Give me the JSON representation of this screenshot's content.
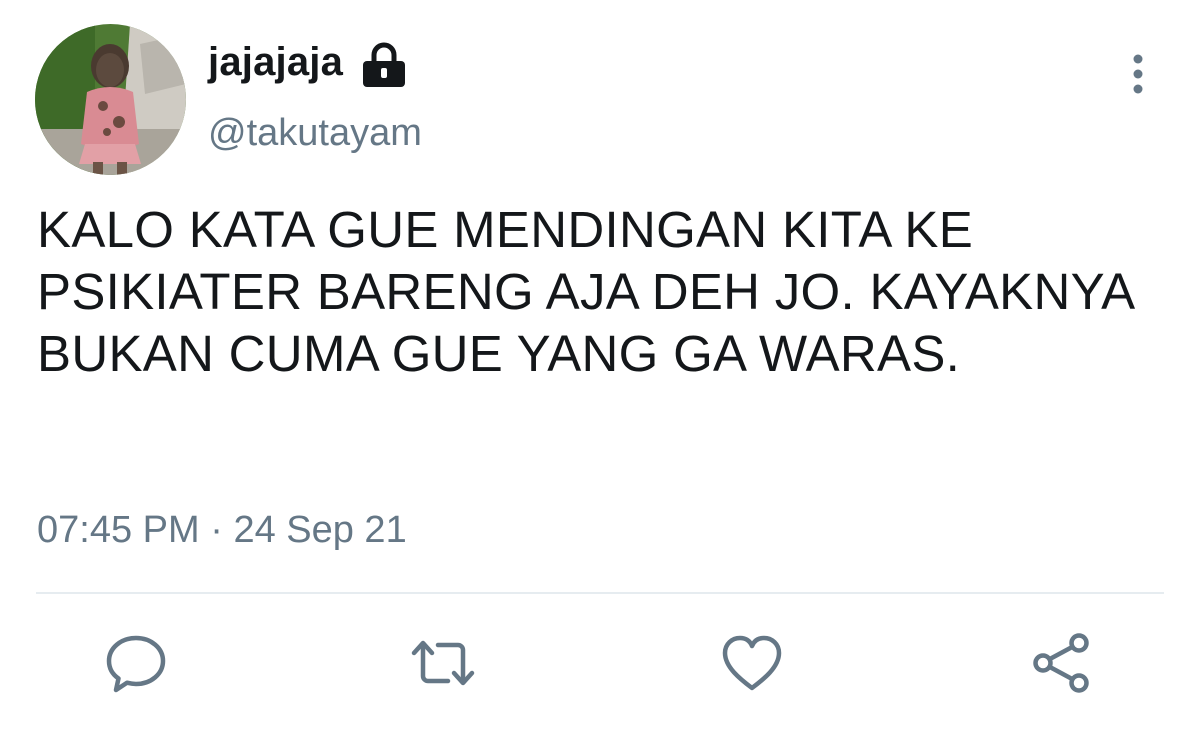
{
  "tweet": {
    "display_name": "jajajaja",
    "handle": "@takutayam",
    "text": "KALO KATA GUE MENDINGAN KITA KE PSIKIATER BARENG AJA DEH JO. KAYAKNYA BUKAN CUMA GUE YANG GA WARAS.",
    "time": "07:45 PM",
    "separator": " · ",
    "date": "24 Sep 21",
    "protected_icon": "lock-icon"
  },
  "actions": {
    "reply_icon": "reply-icon",
    "retweet_icon": "retweet-icon",
    "like_icon": "like-icon",
    "share_icon": "share-icon",
    "more_icon": "more-vertical-icon"
  },
  "colors": {
    "text": "#14171a",
    "secondary": "#657786",
    "divider": "#e6ecf0",
    "background": "#ffffff"
  }
}
